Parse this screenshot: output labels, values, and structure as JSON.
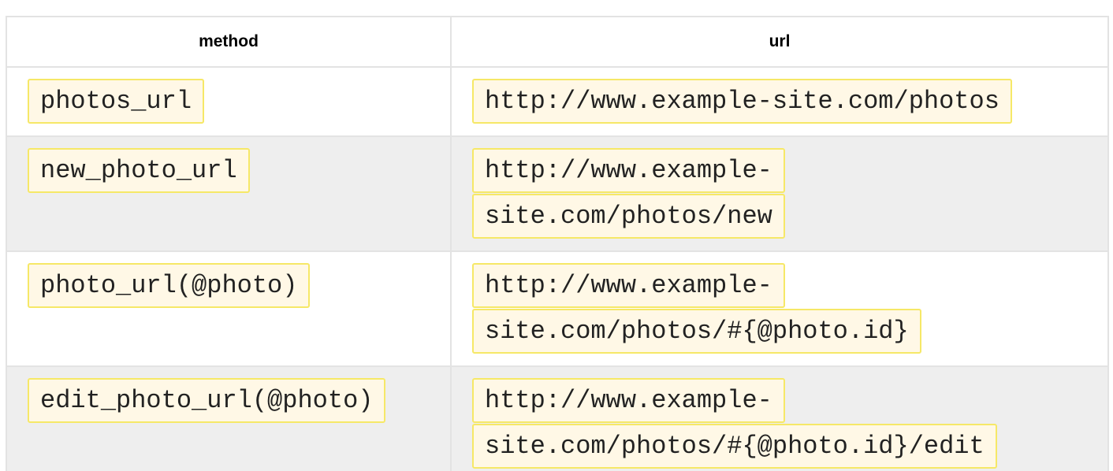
{
  "table": {
    "headers": {
      "method": "method",
      "url": "url"
    },
    "rows": [
      {
        "method": "photos_url",
        "url_line1": "http://www.example-site.com/photos",
        "url_line2": ""
      },
      {
        "method": "new_photo_url",
        "url_line1": "http://www.example-",
        "url_line2": "site.com/photos/new"
      },
      {
        "method": "photo_url(@photo)",
        "url_line1": "http://www.example-",
        "url_line2": "site.com/photos/#{@photo.id}"
      },
      {
        "method": "edit_photo_url(@photo)",
        "url_line1": "http://www.example-",
        "url_line2": "site.com/photos/#{@photo.id}/edit"
      }
    ]
  },
  "colors": {
    "code_background": "#fff8e6",
    "code_border": "#f6e867",
    "stripe_row": "#eeeeee",
    "grid_line": "#e3e3e3"
  }
}
